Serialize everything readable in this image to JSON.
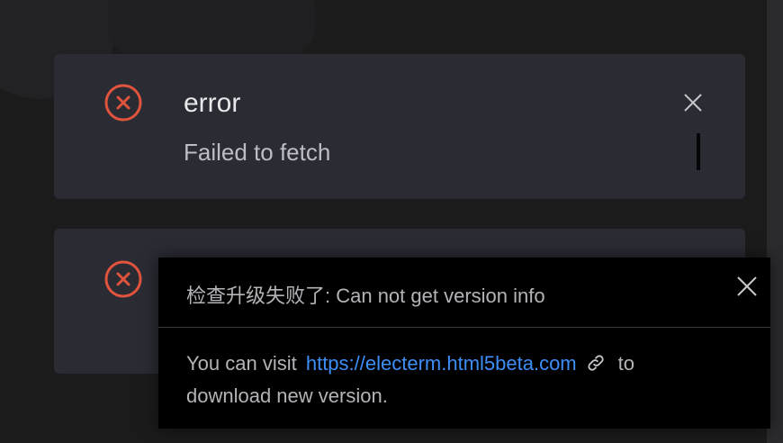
{
  "notifications": [
    {
      "title": "error",
      "description": "Failed to fetch",
      "icon": "error-circle-icon",
      "status_color": "#e0533d"
    },
    {
      "title": "",
      "description": "",
      "icon": "error-circle-icon",
      "status_color": "#e0533d"
    }
  ],
  "popover": {
    "title": "检查升级失败了: Can not get version info",
    "body_prefix": "You can visit",
    "link_text": "https://electerm.html5beta.com",
    "body_suffix_1": "to",
    "body_suffix_2": "download new version.",
    "link_color": "#3e8ef7"
  },
  "icons": {
    "close": "close-icon",
    "link": "link-icon"
  }
}
